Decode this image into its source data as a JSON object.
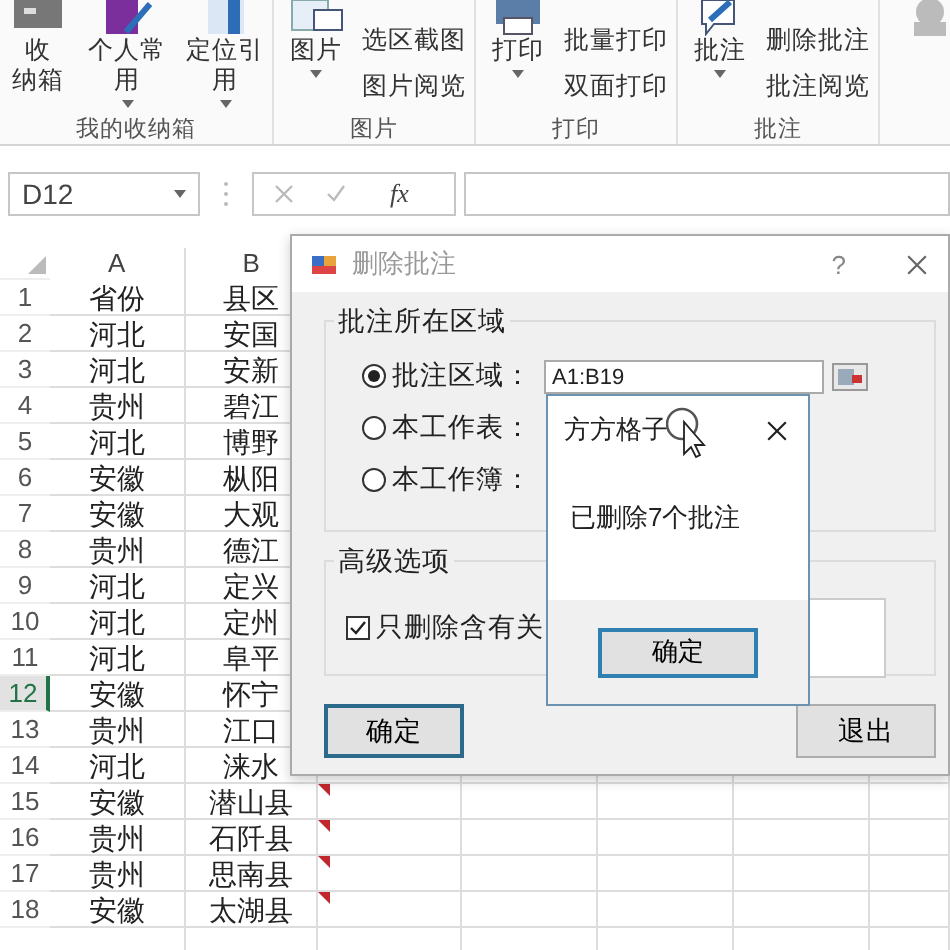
{
  "ribbon": {
    "groups": [
      {
        "label": "我的收纳箱",
        "items": [
          {
            "kind": "large",
            "lines": [
              "收",
              "纳箱"
            ]
          },
          {
            "kind": "large",
            "lines": [
              "个人常",
              "用"
            ],
            "dropdown": true
          },
          {
            "kind": "large",
            "lines": [
              "定位引",
              "用"
            ],
            "dropdown": true
          }
        ]
      },
      {
        "label": "图片",
        "items": [
          {
            "kind": "large",
            "lines": [
              "图片"
            ],
            "dropdown": true
          },
          {
            "kind": "small",
            "lines": [
              "选区截图"
            ]
          },
          {
            "kind": "small",
            "lines": [
              "图片阅览"
            ]
          }
        ]
      },
      {
        "label": "打印",
        "items": [
          {
            "kind": "large",
            "lines": [
              "打印"
            ],
            "dropdown": true
          },
          {
            "kind": "small",
            "lines": [
              "批量打印"
            ]
          },
          {
            "kind": "small",
            "lines": [
              "双面打印"
            ]
          }
        ]
      },
      {
        "label": "批注",
        "items": [
          {
            "kind": "large",
            "lines": [
              "批注"
            ],
            "dropdown": true
          },
          {
            "kind": "small",
            "lines": [
              "删除批注"
            ]
          },
          {
            "kind": "small",
            "lines": [
              "批注阅览"
            ]
          }
        ]
      }
    ]
  },
  "formula_bar": {
    "name_box": "D12",
    "fx": "fx"
  },
  "sheet": {
    "columns": [
      "A",
      "B"
    ],
    "rows": [
      {
        "number": "1",
        "cells": [
          "省份",
          "县区"
        ],
        "selected": false
      },
      {
        "number": "2",
        "cells": [
          "河北",
          "安国"
        ],
        "selected": false
      },
      {
        "number": "3",
        "cells": [
          "河北",
          "安新"
        ],
        "selected": false
      },
      {
        "number": "4",
        "cells": [
          "贵州",
          "碧江"
        ],
        "selected": false
      },
      {
        "number": "5",
        "cells": [
          "河北",
          "博野"
        ],
        "selected": false
      },
      {
        "number": "6",
        "cells": [
          "安徽",
          "枞阳"
        ],
        "selected": false
      },
      {
        "number": "7",
        "cells": [
          "安徽",
          "大观"
        ],
        "selected": false
      },
      {
        "number": "8",
        "cells": [
          "贵州",
          "德江"
        ],
        "selected": false
      },
      {
        "number": "9",
        "cells": [
          "河北",
          "定兴"
        ],
        "selected": false
      },
      {
        "number": "10",
        "cells": [
          "河北",
          "定州"
        ],
        "selected": false
      },
      {
        "number": "11",
        "cells": [
          "河北",
          "阜平"
        ],
        "selected": false
      },
      {
        "number": "12",
        "cells": [
          "安徽",
          "怀宁"
        ],
        "selected": true
      },
      {
        "number": "13",
        "cells": [
          "贵州",
          "江口"
        ],
        "selected": false
      },
      {
        "number": "14",
        "cells": [
          "河北",
          "涞水"
        ],
        "selected": false
      },
      {
        "number": "15",
        "cells": [
          "安徽",
          "潜山县"
        ],
        "selected": false,
        "has_comment": true
      },
      {
        "number": "16",
        "cells": [
          "贵州",
          "石阡县"
        ],
        "selected": false,
        "has_comment": true
      },
      {
        "number": "17",
        "cells": [
          "贵州",
          "思南县"
        ],
        "selected": false,
        "has_comment": true
      },
      {
        "number": "18",
        "cells": [
          "安徽",
          "太湖县"
        ],
        "selected": false,
        "has_comment": true
      }
    ]
  },
  "dialog": {
    "title": "删除批注",
    "help": "?",
    "region_group": "批注所在区域",
    "radios": [
      {
        "label": "批注区域：",
        "value": "A1:B19",
        "kind": "field",
        "selected": true
      },
      {
        "label": "本工作表：",
        "kind": "text",
        "selected": false
      },
      {
        "label": "本工作簿：",
        "kind": "text",
        "selected": false
      }
    ],
    "advanced_group": "高级选项",
    "checkbox": {
      "label": "只删除含有关",
      "checked": true
    },
    "ok": "确定",
    "exit": "退出"
  },
  "message": {
    "title": "方方格子",
    "text": "已删除7个批注",
    "ok": "确定"
  }
}
